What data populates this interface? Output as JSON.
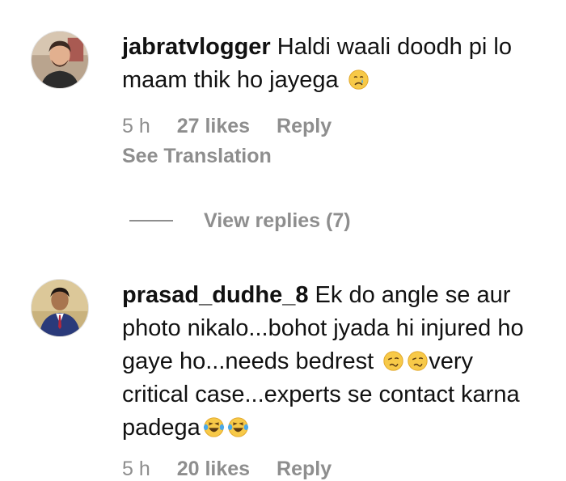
{
  "comments": [
    {
      "username": "jabratvlogger",
      "text": "Haldi waali doodh pi lo maam thik ho jayega",
      "emoji_after": "crying-face-icon",
      "time": "5 h",
      "likes": "27 likes",
      "reply": "Reply",
      "translate": "See Translation",
      "view_replies": "View replies (7)"
    },
    {
      "username": "prasad_dudhe_8",
      "text_part1": "Ek do angle se aur photo nikalo...bohot jyada hi injured ho gaye ho...needs bedrest",
      "text_part2": "very critical case...experts se contact karna padega",
      "time": "5 h",
      "likes": "20 likes",
      "reply": "Reply"
    }
  ],
  "colors": {
    "text": "#111111",
    "muted": "#8e8e8e",
    "emoji_yellow": "#f7c948"
  }
}
